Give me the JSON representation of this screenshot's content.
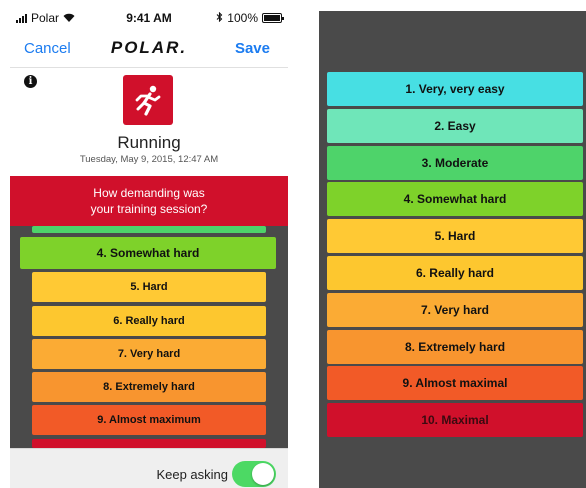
{
  "status_bar": {
    "carrier": "Polar",
    "time": "9:41 AM",
    "battery": "100%"
  },
  "nav": {
    "cancel": "Cancel",
    "logo": "POLAR.",
    "save": "Save"
  },
  "icons": {
    "info": "info-icon",
    "sport": "running-icon",
    "signal": "signal-icon",
    "wifi": "wifi-icon",
    "bluetooth": "bluetooth-icon",
    "battery": "battery-icon"
  },
  "session": {
    "sport": "Running",
    "date": "Tuesday, May 9, 2015, 12:47 AM"
  },
  "question": {
    "line1": "How demanding was",
    "line2": "your training session?"
  },
  "picker": {
    "selected": "4. Somewhat hard",
    "items": [
      {
        "label": "5. Hard",
        "color": "#ffc934"
      },
      {
        "label": "6. Really hard",
        "color": "#fdc72f"
      },
      {
        "label": "7. Very hard",
        "color": "#fbab34"
      },
      {
        "label": "8. Extremely hard",
        "color": "#f8952f"
      },
      {
        "label": "9. Almost maximum",
        "color": "#f25a27"
      }
    ]
  },
  "keep_asking": {
    "label": "Keep asking",
    "enabled": true
  },
  "scale": [
    {
      "label": "1. Very, very easy",
      "color": "#47dfe3"
    },
    {
      "label": "2. Easy",
      "color": "#6fe6b9"
    },
    {
      "label": "3. Moderate",
      "color": "#4ed36a"
    },
    {
      "label": "4. Somewhat hard",
      "color": "#7ed22a"
    },
    {
      "label": "5. Hard",
      "color": "#ffc934"
    },
    {
      "label": "6. Really hard",
      "color": "#fdc72f"
    },
    {
      "label": "7. Very hard",
      "color": "#fbab34"
    },
    {
      "label": "8. Extremely hard",
      "color": "#f8952f"
    },
    {
      "label": "9. Almost maximal",
      "color": "#f25a27"
    },
    {
      "label": "10. Maximal",
      "color": "#d0102b"
    }
  ],
  "colors": {
    "brand_red": "#d0102b",
    "ios_blue": "#1c7cf0",
    "toggle_on": "#4cd964",
    "scale_background": "#4a4a4a"
  }
}
